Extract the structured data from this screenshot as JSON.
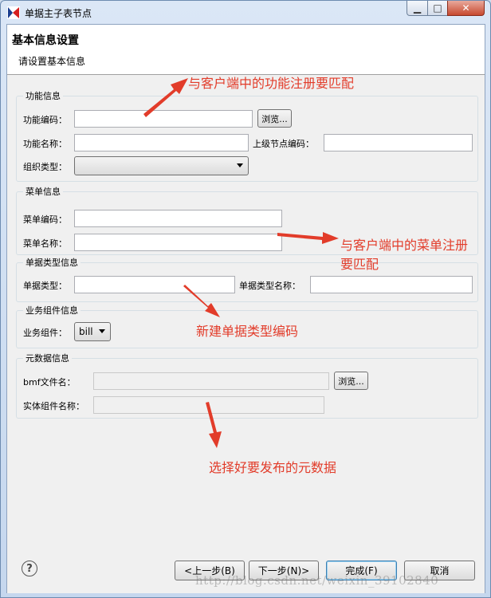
{
  "window": {
    "title": "单据主子表节点",
    "min_glyph": "▁",
    "max_glyph": "□",
    "close_glyph": "✕"
  },
  "header": {
    "title": "基本信息设置",
    "subtitle": "请设置基本信息"
  },
  "groups": {
    "func": {
      "label": "功能信息",
      "code_label": "功能编码：",
      "code_value": "",
      "browse": "浏览...",
      "name_label": "功能名称：",
      "name_value": "",
      "parent_label": "上级节点编码：",
      "parent_value": "",
      "org_label": "组织类型：",
      "org_value": ""
    },
    "menu": {
      "label": "菜单信息",
      "code_label": "菜单编码：",
      "code_value": "",
      "name_label": "菜单名称：",
      "name_value": ""
    },
    "billtype": {
      "label": "单据类型信息",
      "type_label": "单据类型：",
      "type_value": "",
      "typename_label": "单据类型名称：",
      "typename_value": ""
    },
    "biz": {
      "label": "业务组件信息",
      "comp_label": "业务组件：",
      "comp_value": "bill"
    },
    "meta": {
      "label": "元数据信息",
      "bmf_label": "bmf文件名：",
      "bmf_value": "",
      "browse": "浏览...",
      "entity_label": "实体组件名称：",
      "entity_value": ""
    }
  },
  "footer": {
    "help_glyph": "?",
    "back": "<上一步(B)",
    "next": "下一步(N)>",
    "finish": "完成(F)",
    "cancel": "取消"
  },
  "annotations": {
    "a1": "与客户端中的功能注册要匹配",
    "a2_line1": "与客户端中的菜单注册",
    "a2_line2": "要匹配",
    "a3": "新建单据类型编码",
    "a4": "选择好要发布的元数据",
    "color": "#e23c2a"
  },
  "watermark": "http://blog.csdn.net/weixin_39102840",
  "icons": {
    "app": "app-logo-icon",
    "help": "help-icon",
    "dropdown": "chevron-down-icon"
  }
}
